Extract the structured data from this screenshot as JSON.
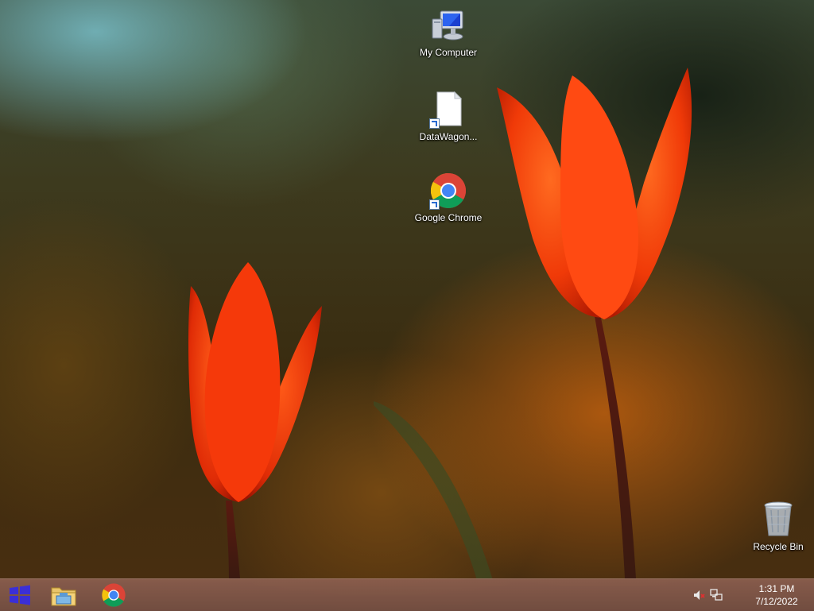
{
  "desktop": {
    "icons": [
      {
        "id": "my-computer",
        "label": "My Computer",
        "icon": "computer-icon",
        "shortcut": false
      },
      {
        "id": "datawagon",
        "label": "DataWagon...",
        "icon": "document-icon",
        "shortcut": true
      },
      {
        "id": "google-chrome",
        "label": "Google Chrome",
        "icon": "chrome-icon",
        "shortcut": true
      },
      {
        "id": "recycle-bin",
        "label": "Recycle Bin",
        "icon": "recycle-bin-icon",
        "shortcut": false
      }
    ]
  },
  "taskbar": {
    "start_icon": "windows-logo-icon",
    "pinned": [
      {
        "id": "file-explorer",
        "icon": "folder-icon"
      },
      {
        "id": "chrome",
        "icon": "chrome-icon"
      }
    ],
    "tray": [
      {
        "id": "volume",
        "icon": "volume-muted-icon"
      },
      {
        "id": "network",
        "icon": "network-icon"
      }
    ],
    "clock": {
      "time": "1:31 PM",
      "date": "7/12/2022"
    }
  },
  "colors": {
    "start_accent": "#3b2fd6",
    "chrome_red": "#db4437",
    "chrome_yellow": "#f4c20d",
    "chrome_green": "#0f9d58",
    "chrome_blue": "#4285f4",
    "tulip_orange": "#ff4a12"
  }
}
